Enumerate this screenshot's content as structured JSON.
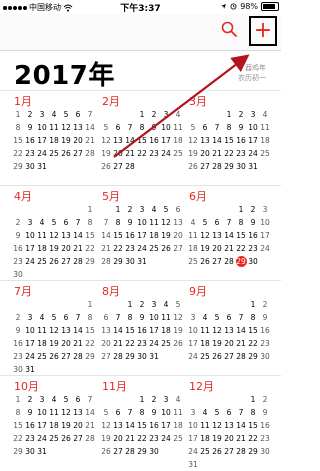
{
  "status_bar": {
    "carrier": "中国移动",
    "time": "下午3:37",
    "battery_percent": "98%",
    "signal_dots": 5
  },
  "nav": {
    "search_icon": "search-icon",
    "add_label": "+"
  },
  "year_title": "2017年",
  "lunar": {
    "year_label": "丁酉鸡年",
    "day_label": "农历初一"
  },
  "today": {
    "month": 6,
    "day": 29
  },
  "months": [
    {
      "name": "1月",
      "offset": 0,
      "days": 31
    },
    {
      "name": "2月",
      "offset": 3,
      "days": 28
    },
    {
      "name": "3月",
      "offset": 3,
      "days": 31
    },
    {
      "name": "4月",
      "offset": 6,
      "days": 30
    },
    {
      "name": "5月",
      "offset": 1,
      "days": 31
    },
    {
      "name": "6月",
      "offset": 4,
      "days": 30
    },
    {
      "name": "7月",
      "offset": 6,
      "days": 31
    },
    {
      "name": "8月",
      "offset": 2,
      "days": 31
    },
    {
      "name": "9月",
      "offset": 5,
      "days": 30
    },
    {
      "name": "10月",
      "offset": 0,
      "days": 31
    },
    {
      "name": "11月",
      "offset": 3,
      "days": 30
    },
    {
      "name": "12月",
      "offset": 5,
      "days": 31
    }
  ],
  "colors": {
    "accent": "#e6281e",
    "annotation": "#b3141e"
  }
}
